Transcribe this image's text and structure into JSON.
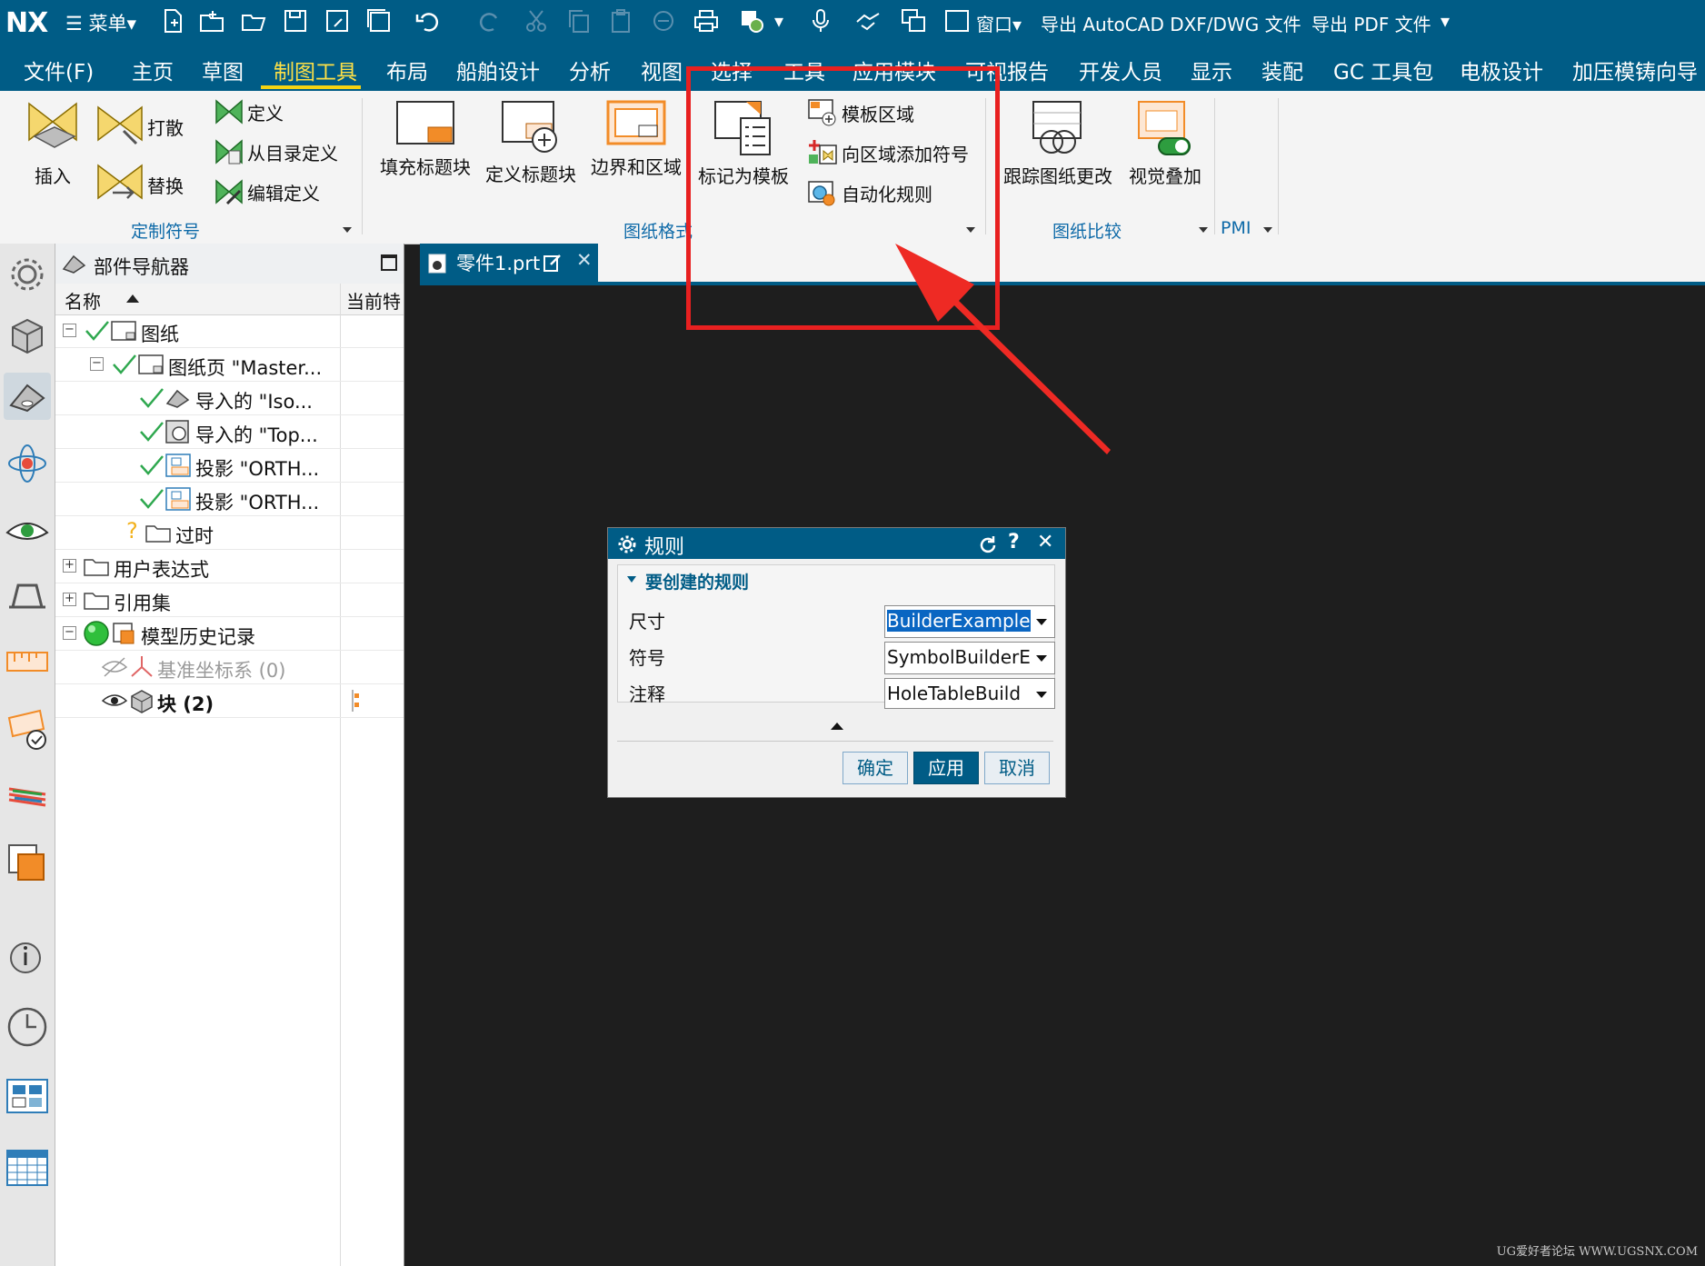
{
  "quick_access": {
    "logo": "NX",
    "menu_label": "☰ 菜单▾",
    "window_label": "窗口▾",
    "export_dxf": "导出 AutoCAD DXF/DWG 文件",
    "export_pdf": "导出 PDF 文件",
    "overflow": "▾"
  },
  "tabs": [
    {
      "label": "文件(F)"
    },
    {
      "label": "主页"
    },
    {
      "label": "草图"
    },
    {
      "label": "制图工具"
    },
    {
      "label": "布局"
    },
    {
      "label": "船舶设计"
    },
    {
      "label": "分析"
    },
    {
      "label": "视图"
    },
    {
      "label": "选择"
    },
    {
      "label": "工具"
    },
    {
      "label": "应用模块"
    },
    {
      "label": "可视报告"
    },
    {
      "label": "开发人员"
    },
    {
      "label": "显示"
    },
    {
      "label": "装配"
    },
    {
      "label": "GC 工具包"
    },
    {
      "label": "电极设计"
    },
    {
      "label": "加压模铸向导"
    }
  ],
  "ribbon": {
    "custom_symbol": {
      "group": "定制符号",
      "insert": "插入",
      "explode": "打散",
      "replace": "替换",
      "define": "定义",
      "define_from_catalog": "从目录定义",
      "edit_definition": "编辑定义"
    },
    "drawing_format": {
      "group": "图纸格式",
      "fill_title_block": "填充标题块",
      "define_title_block": "定义标题块",
      "borders_zones": "边界和区域",
      "mark_as_template": "标记为模板",
      "template_region": "模板区域",
      "add_symbol_to_region": "向区域添加符号",
      "automation_rules": "自动化规则"
    },
    "drawing_compare": {
      "group": "图纸比较",
      "track_changes": "跟踪图纸更改",
      "visual_overlay": "视觉叠加"
    },
    "pmi": {
      "group": "PMI"
    }
  },
  "navigator": {
    "title": "部件导航器",
    "col_name": "名称",
    "col_current": "当前特",
    "rows": [
      {
        "label": "图纸"
      },
      {
        "label": "图纸页 \"Master..."
      },
      {
        "label": "导入的 \"Iso..."
      },
      {
        "label": "导入的 \"Top..."
      },
      {
        "label": "投影 \"ORTH..."
      },
      {
        "label": "投影 \"ORTH..."
      },
      {
        "label": "过时"
      },
      {
        "label": "用户表达式"
      },
      {
        "label": "引用集"
      },
      {
        "label": "模型历史记录"
      },
      {
        "label": "基准坐标系 (0)"
      },
      {
        "label": "块 (2)"
      }
    ]
  },
  "graphics": {
    "tab_label": "零件1.prt",
    "watermark": "UG爱好者论坛 WWW.UGSNX.COM"
  },
  "dialog": {
    "title": "规则",
    "section": "要创建的规则",
    "fields": [
      {
        "label": "尺寸",
        "value": "BuilderExample"
      },
      {
        "label": "符号",
        "value": "SymbolBuilderE"
      },
      {
        "label": "注释",
        "value": "HoleTableBuild"
      }
    ],
    "ok": "确定",
    "apply": "应用",
    "cancel": "取消"
  },
  "colors": {
    "brand_blue": "#005c86",
    "active_tab": "#fde047",
    "callout_red": "#e82020"
  }
}
